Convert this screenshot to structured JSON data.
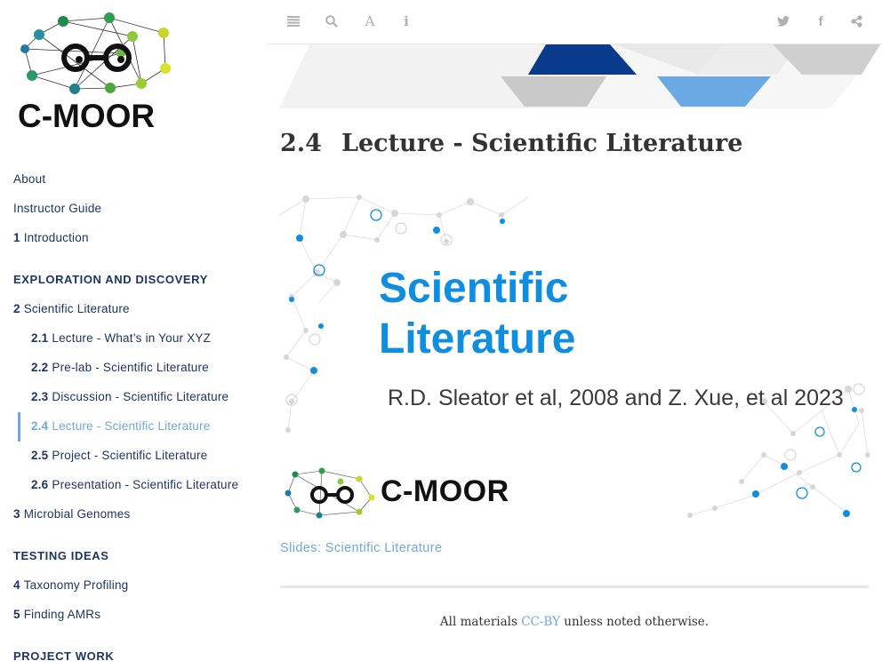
{
  "sidebar": {
    "logo_text": "C-MOOR",
    "items": [
      {
        "num": "",
        "label": "About"
      },
      {
        "num": "",
        "label": "Instructor Guide"
      },
      {
        "num": "1",
        "label": "Introduction"
      },
      {
        "part": "EXPLORATION AND DISCOVERY"
      },
      {
        "num": "2",
        "label": "Scientific Literature"
      },
      {
        "num": "2.1",
        "label": "Lecture - What’s in Your XYZ"
      },
      {
        "num": "2.2",
        "label": "Pre-lab - Scientific Literature"
      },
      {
        "num": "2.3",
        "label": "Discussion - Scientific Literature"
      },
      {
        "num": "2.4",
        "label": "Lecture - Scientific Literature"
      },
      {
        "num": "2.5",
        "label": "Project - Scientific Literature"
      },
      {
        "num": "2.6",
        "label": "Presentation - Scientific Literature"
      },
      {
        "num": "3",
        "label": "Microbial Genomes"
      },
      {
        "part": "TESTING IDEAS"
      },
      {
        "num": "4",
        "label": "Taxonomy Profiling"
      },
      {
        "num": "5",
        "label": "Finding AMRs"
      },
      {
        "part": "PROJECT WORK"
      }
    ]
  },
  "toolbar": {
    "left_icons": [
      "menu-icon",
      "search-icon",
      "font-icon",
      "info-icon"
    ],
    "right_icons": [
      "twitter-icon",
      "facebook-icon",
      "share-icon"
    ],
    "font_glyph": "A",
    "info_glyph": "i",
    "facebook_glyph": "f"
  },
  "main": {
    "section_number": "2.4",
    "section_title": "Lecture - Scientific Literature",
    "slide": {
      "title_line1": "Scientific",
      "title_line2": "Literature",
      "subtitle": "R.D. Sleator et al, 2008 and Z. Xue, et al 2023",
      "logo_text": "C-MOOR"
    },
    "slides_link": "Slides: Scientific Literature",
    "footer": {
      "prefix": "All materials ",
      "license": "CC-BY",
      "suffix": " unless noted otherwise."
    }
  },
  "colors": {
    "nav_text": "#1b3566",
    "accent": "#6fa8dc",
    "slide_title": "#0f8ee0",
    "banner_dark": "#0a3a8c",
    "banner_light": "#6aa9e4"
  }
}
